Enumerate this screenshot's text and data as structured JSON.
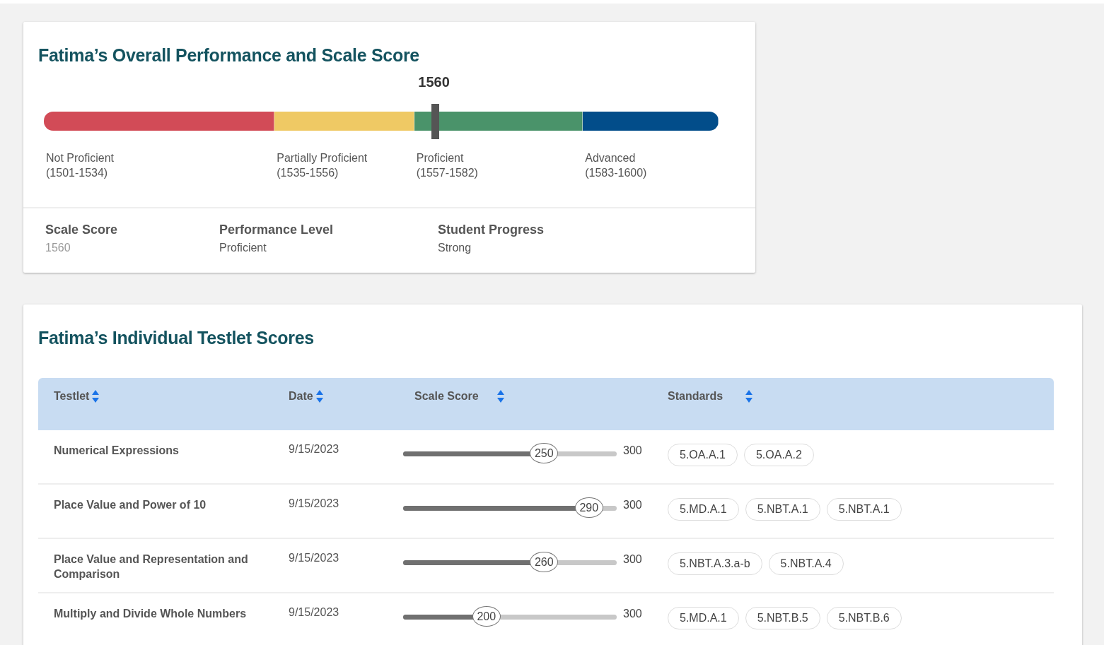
{
  "overall": {
    "title": "Fatima’s Overall Performance and Scale Score",
    "score": "1560",
    "marker": {
      "level": 0.58
    },
    "bands": [
      {
        "name": "Not Proficient",
        "range": "(1501-1534)",
        "color": "#d24b57"
      },
      {
        "name": "Partially Proficient",
        "range": "(1535-1556)",
        "color": "#efc964"
      },
      {
        "name": "Proficient",
        "range": "(1557-1582)",
        "color": "#4a936a"
      },
      {
        "name": "Advanced",
        "range": "(1583-1600)",
        "color": "#024d8a"
      }
    ],
    "stats": [
      {
        "label": "Scale Score",
        "value": "1560",
        "kind": "score"
      },
      {
        "label": "Performance Level",
        "value": "Proficient",
        "kind": "text"
      },
      {
        "label": "Student Progress",
        "value": "Strong",
        "kind": "text"
      }
    ]
  },
  "testlets": {
    "title": "Fatima’s Individual Testlet Scores",
    "columns": [
      {
        "label": "Testlet"
      },
      {
        "label": "Date"
      },
      {
        "label": "Scale Score"
      },
      {
        "label": "Standards"
      }
    ],
    "rows": [
      {
        "testlet": "Numerical Expressions",
        "date": "9/15/2023",
        "score": {
          "value": "250",
          "level": 0.66,
          "max": "300"
        },
        "standards": [
          "5.OA.A.1",
          "5.OA.A.2"
        ]
      },
      {
        "testlet": "Place Value and Power of 10",
        "date": "9/15/2023",
        "score": {
          "value": "290",
          "level": 0.87,
          "max": "300"
        },
        "standards": [
          "5.MD.A.1",
          "5.NBT.A.1",
          "5.NBT.A.1"
        ]
      },
      {
        "testlet": "Place Value and Representation and Comparison",
        "date": "9/15/2023",
        "score": {
          "value": "260",
          "level": 0.66,
          "max": "300"
        },
        "standards": [
          "5.NBT.A.3.a-b",
          "5.NBT.A.4"
        ]
      },
      {
        "testlet": "Multiply and Divide Whole Numbers",
        "date": "9/15/2023",
        "score": {
          "value": "200",
          "level": 0.39,
          "max": "300"
        },
        "standards": [
          "5.MD.A.1",
          "5.NBT.B.5",
          "5.NBT.B.6"
        ]
      }
    ]
  }
}
